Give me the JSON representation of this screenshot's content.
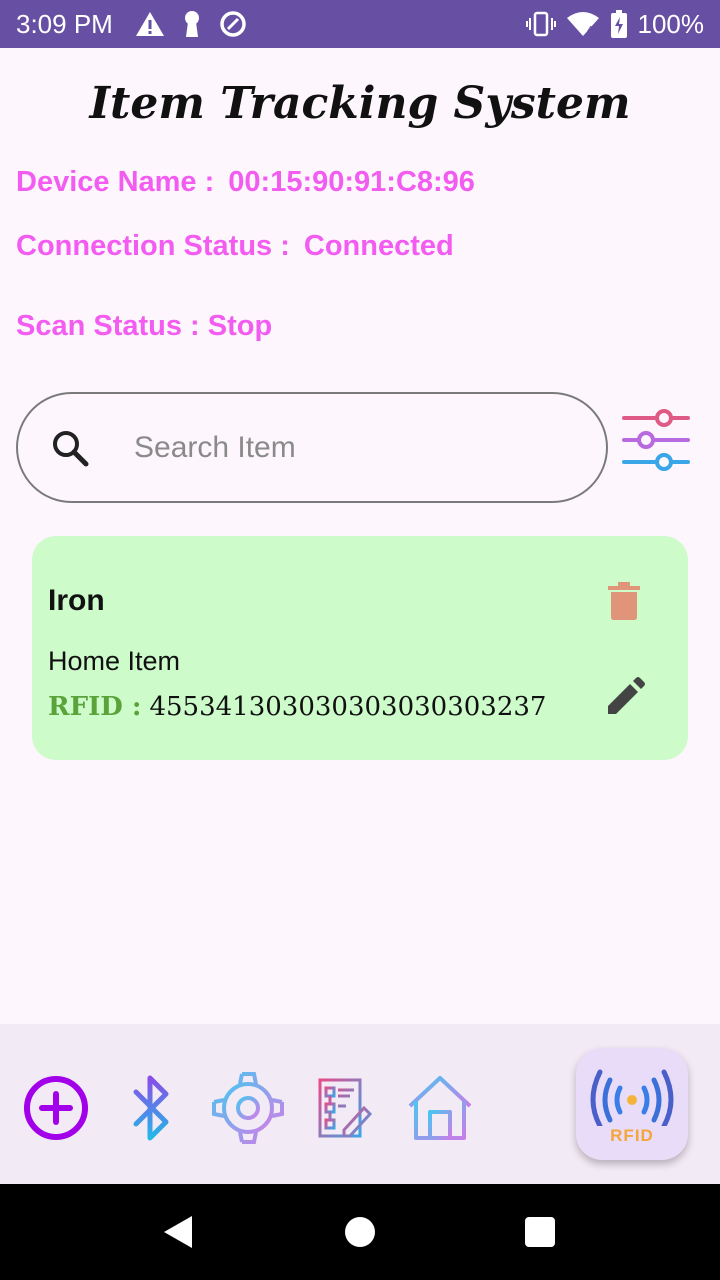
{
  "status_bar": {
    "time": "3:09 PM",
    "battery": "100%",
    "icons": [
      "alert-icon",
      "keyhole-icon",
      "data-saver-icon",
      "vibrate-icon",
      "wifi-icon",
      "battery-charging-icon"
    ]
  },
  "header": {
    "title": "Item Tracking System"
  },
  "device_info": {
    "device_name_label": "Device Name :",
    "device_name_value": "00:15:90:91:C8:96",
    "connection_label": "Connection Status :",
    "connection_value": "Connected",
    "scan_label": "Scan Status :",
    "scan_value": "Stop"
  },
  "search": {
    "placeholder": "Search Item",
    "value": ""
  },
  "items": [
    {
      "name": "Iron",
      "category": "Home Item",
      "rfid_label": "RFID :",
      "rfid_value": "455341303030303030303237"
    }
  ],
  "bottom_nav": {
    "items": [
      "add-icon",
      "bluetooth-icon",
      "settings-icon",
      "report-icon",
      "home-icon"
    ],
    "fab_label": "RFID"
  },
  "colors": {
    "status_bar": "#6750a4",
    "info_text": "#f25cf0",
    "card_bg": "#cdfbca",
    "rfid_label": "#5aa23a",
    "delete_icon": "#e0957a"
  }
}
